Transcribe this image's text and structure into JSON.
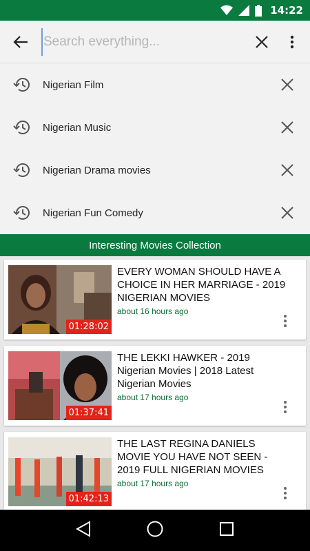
{
  "status_bar": {
    "time": "14:22"
  },
  "search": {
    "placeholder": "Search everything...",
    "value": ""
  },
  "history": [
    {
      "label": "Nigerian Film"
    },
    {
      "label": "Nigerian Music"
    },
    {
      "label": "Nigerian Drama movies"
    },
    {
      "label": "Nigerian Fun Comedy"
    }
  ],
  "section": {
    "title": "Interesting Movies Collection"
  },
  "videos": [
    {
      "title": "EVERY WOMAN SHOULD HAVE A CHOICE IN HER MARRIAGE - 2019 NIGERIAN MOVIES",
      "time": "about 16 hours ago",
      "duration": "01:28:02"
    },
    {
      "title": "THE LEKKI HAWKER - 2019 Nigerian Movies | 2018 Latest Nigerian Movies",
      "time": "about 17 hours ago",
      "duration": "01:37:41"
    },
    {
      "title": "THE LAST REGINA DANIELS MOVIE YOU HAVE NOT SEEN - 2019 FULL NIGERIAN MOVIES",
      "time": "about 17 hours ago",
      "duration": "01:42:13"
    }
  ],
  "colors": {
    "brand_green": "#0b7a3f",
    "duration_red": "#e2231a",
    "time_green": "#0b6b35"
  },
  "icons": {
    "back": "arrow-back-icon",
    "clear": "close-icon",
    "more": "more-vert-icon",
    "history": "history-icon",
    "remove": "close-icon"
  }
}
